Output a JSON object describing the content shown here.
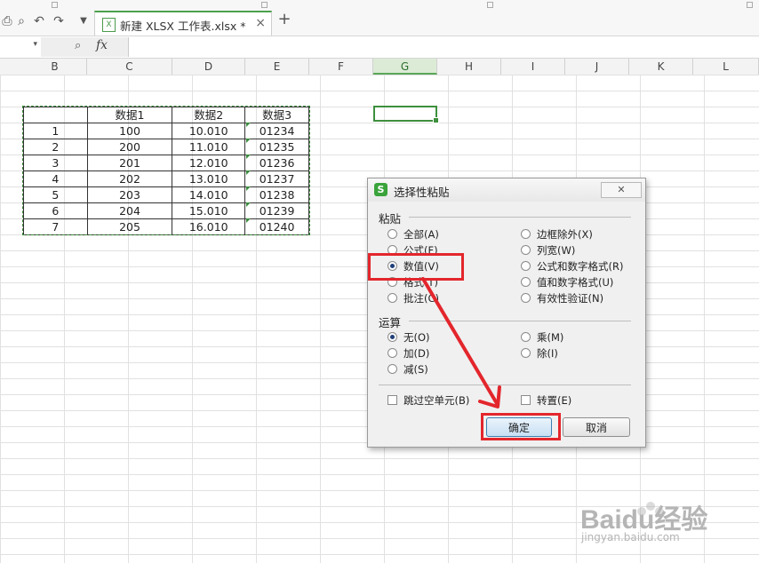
{
  "tab": {
    "title": "新建 XLSX 工作表.xlsx *",
    "close_glyph": "×",
    "new_tab_glyph": "+"
  },
  "formula_bar": {
    "fx_label": "fx",
    "zoom_glyph": "⌕",
    "namebox_dropdown": "▾"
  },
  "columns": [
    "B",
    "C",
    "D",
    "E",
    "F",
    "G",
    "H",
    "I",
    "J",
    "K",
    "L"
  ],
  "selected_column": "G",
  "table": {
    "headers": [
      "",
      "数据1",
      "数据2",
      "数据3"
    ],
    "rows": [
      [
        "1",
        "100",
        "10.010",
        "01234"
      ],
      [
        "2",
        "200",
        "11.010",
        "01235"
      ],
      [
        "3",
        "201",
        "12.010",
        "01236"
      ],
      [
        "4",
        "202",
        "13.010",
        "01237"
      ],
      [
        "5",
        "203",
        "14.010",
        "01238"
      ],
      [
        "6",
        "204",
        "15.010",
        "01239"
      ],
      [
        "7",
        "205",
        "16.010",
        "01240"
      ]
    ]
  },
  "dialog": {
    "logo": "S",
    "title": "选择性粘贴",
    "close_glyph": "✕",
    "paste_section": "粘贴",
    "paste_options_left": [
      "全部(A)",
      "公式(F)",
      "数值(V)",
      "格式(T)",
      "批注(C)"
    ],
    "paste_options_right": [
      "边框除外(X)",
      "列宽(W)",
      "公式和数字格式(R)",
      "值和数字格式(U)",
      "有效性验证(N)"
    ],
    "paste_selected": "数值(V)",
    "operation_section": "运算",
    "operation_left": [
      "无(O)",
      "加(D)",
      "减(S)"
    ],
    "operation_right": [
      "乘(M)",
      "除(I)"
    ],
    "operation_selected": "无(O)",
    "skip_blanks": "跳过空单元(B)",
    "transpose": "转置(E)",
    "ok_label": "确定",
    "cancel_label": "取消"
  },
  "watermark": {
    "text": "Baidu经验",
    "url": "jingyan.baidu.com"
  },
  "colors": {
    "accent_green": "#3d8f3d",
    "annotation_red": "#e3262c"
  }
}
